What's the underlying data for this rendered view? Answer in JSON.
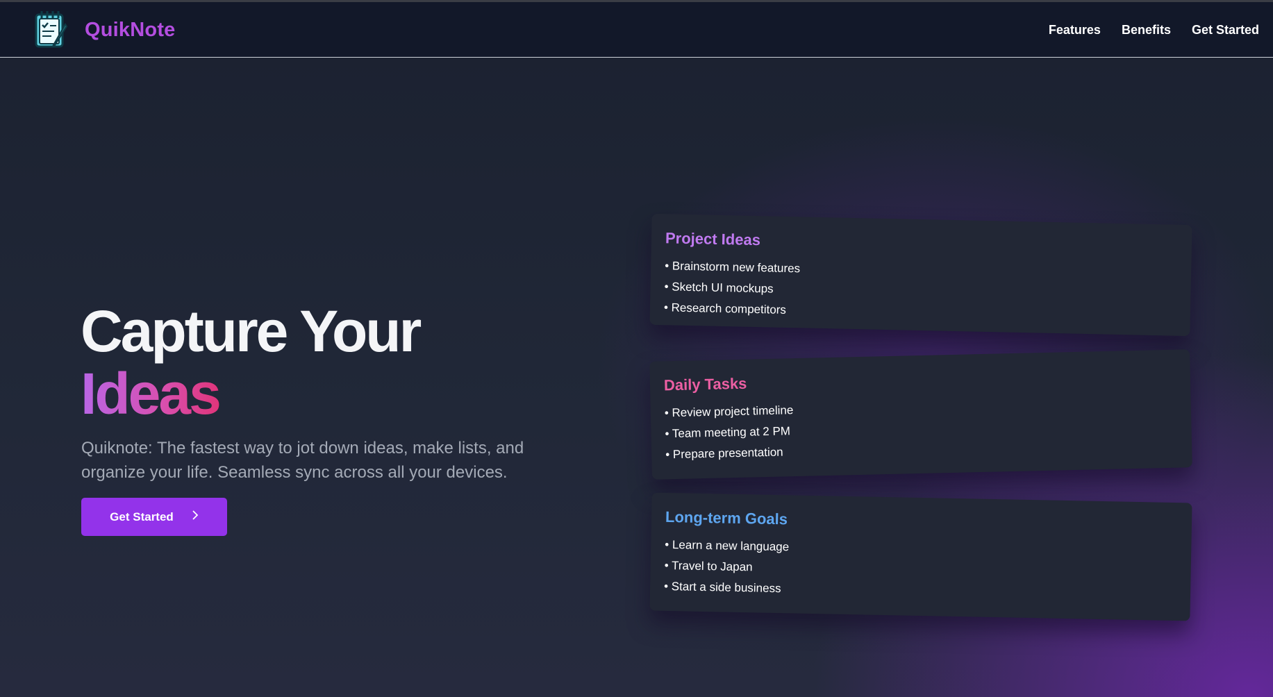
{
  "header": {
    "brand": "QuikNote",
    "logo_icon": "notepad-icon",
    "nav": [
      "Features",
      "Benefits",
      "Get Started"
    ]
  },
  "hero": {
    "title_line1": "Capture Your",
    "title_line2": "Ideas",
    "subtitle": "Quiknote: The fastest way to jot down ideas, make lists, and organize your life. Seamless sync across all your devices.",
    "cta_label": "Get Started",
    "cta_icon": "chevron-right-icon"
  },
  "cards": [
    {
      "title": "Project Ideas",
      "items": [
        "• Brainstorm new features",
        "• Sketch UI mockups",
        "• Research competitors"
      ],
      "accent": "#c07af0"
    },
    {
      "title": "Daily Tasks",
      "items": [
        "• Review project timeline",
        "• Team meeting at 2 PM",
        "• Prepare presentation"
      ],
      "accent": "#ec5fa3"
    },
    {
      "title": "Long-term Goals",
      "items": [
        "• Learn a new language",
        "• Travel to Japan",
        "• Start a side business"
      ],
      "accent": "#5ea6f0"
    }
  ],
  "colors": {
    "brand": "#b44ee0",
    "cta": "#9333ea",
    "header_bg": "#121829"
  }
}
